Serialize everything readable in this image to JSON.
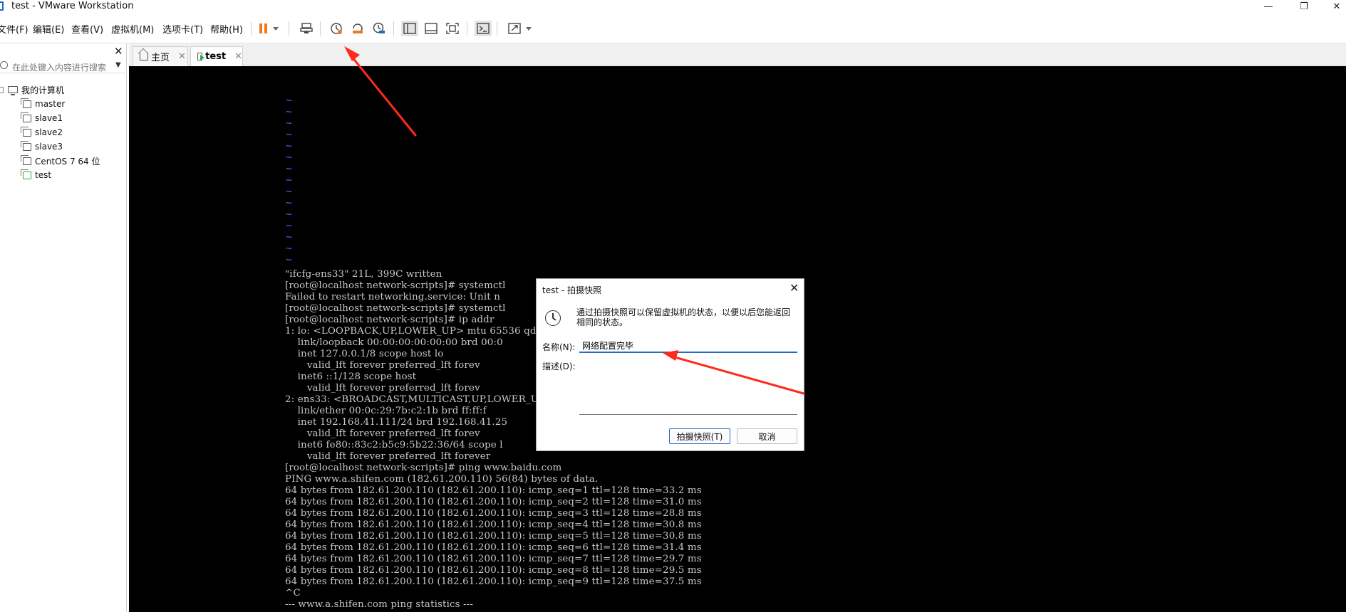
{
  "window": {
    "title": "test - VMware Workstation",
    "controls": {
      "minimize": "—",
      "restore": "❐",
      "close": "✕"
    }
  },
  "menu": [
    {
      "key": "file",
      "label": "文件(F)"
    },
    {
      "key": "edit",
      "label": "编辑(E)"
    },
    {
      "key": "view",
      "label": "查看(V)"
    },
    {
      "key": "vm",
      "label": "虚拟机(M)"
    },
    {
      "key": "tabs",
      "label": "选项卡(T)"
    },
    {
      "key": "help",
      "label": "帮助(H)"
    }
  ],
  "toolbar": {
    "icons": [
      "pause-icon",
      "dropdown-icon",
      "send-ctrl-alt-del-icon",
      "take-snapshot-icon",
      "revert-snapshot-icon",
      "snapshot-manager-icon",
      "library-view-icon",
      "thumbnail-bar-icon",
      "fullscreen-icon",
      "console-view-icon",
      "stretch-guest-icon"
    ],
    "accent": "#f07a1a"
  },
  "library": {
    "close": "✕",
    "search_placeholder": "在此处键入内容进行搜索",
    "dropdown": "▼",
    "root_label": "我的计算机",
    "items": [
      {
        "label": "master"
      },
      {
        "label": "slave1"
      },
      {
        "label": "slave2"
      },
      {
        "label": "slave3"
      },
      {
        "label": "CentOS 7 64 位"
      },
      {
        "label": "test"
      }
    ]
  },
  "tabs": [
    {
      "label": "主页",
      "close": "✕",
      "active": false
    },
    {
      "label": "test",
      "close": "✕",
      "active": true
    }
  ],
  "console": {
    "tilde": "~",
    "lines": [
      "\"ifcfg-ens33\" 21L, 399C written",
      "[root@localhost network-scripts]# systemctl",
      "Failed to restart networking.service: Unit n",
      "[root@localhost network-scripts]# systemctl",
      "[root@localhost network-scripts]# ip addr",
      "1: lo: <LOOPBACK,UP,LOWER_UP> mtu 65536 qdis",
      "    link/loopback 00:00:00:00:00:00 brd 00:0",
      "    inet 127.0.0.1/8 scope host lo",
      "       valid_lft forever preferred_lft forev",
      "    inet6 ::1/128 scope host",
      "       valid_lft forever preferred_lft forev",
      "2: ens33: <BROADCAST,MULTICAST,UP,LOWER_UP>",
      "    link/ether 00:0c:29:7b:c2:1b brd ff:ff:f",
      "    inet 192.168.41.111/24 brd 192.168.41.25",
      "       valid_lft forever preferred_lft forev",
      "    inet6 fe80::83c2:b5c9:5b22:36/64 scope l",
      "       valid_lft forever preferred_lft forever",
      "[root@localhost network-scripts]# ping www.baidu.com",
      "PING www.a.shifen.com (182.61.200.110) 56(84) bytes of data.",
      "64 bytes from 182.61.200.110 (182.61.200.110): icmp_seq=1 ttl=128 time=33.2 ms",
      "64 bytes from 182.61.200.110 (182.61.200.110): icmp_seq=2 ttl=128 time=31.0 ms",
      "64 bytes from 182.61.200.110 (182.61.200.110): icmp_seq=3 ttl=128 time=28.8 ms",
      "64 bytes from 182.61.200.110 (182.61.200.110): icmp_seq=4 ttl=128 time=30.8 ms",
      "64 bytes from 182.61.200.110 (182.61.200.110): icmp_seq=5 ttl=128 time=30.8 ms",
      "64 bytes from 182.61.200.110 (182.61.200.110): icmp_seq=6 ttl=128 time=31.4 ms",
      "64 bytes from 182.61.200.110 (182.61.200.110): icmp_seq=7 ttl=128 time=29.7 ms",
      "64 bytes from 182.61.200.110 (182.61.200.110): icmp_seq=8 ttl=128 time=29.5 ms",
      "64 bytes from 182.61.200.110 (182.61.200.110): icmp_seq=9 ttl=128 time=37.5 ms",
      "^C",
      "--- www.a.shifen.com ping statistics ---"
    ]
  },
  "snapshot_dialog": {
    "title": "test - 拍摄快照",
    "close": "✕",
    "description": "通过拍摄快照可以保留虚拟机的状态，以便以后您能返回相同的状态。",
    "name_label": "名称(N):",
    "name_value": "网络配置完毕",
    "desc_label": "描述(D):",
    "desc_value": "",
    "take_button": "拍摄快照(T)",
    "cancel_button": "取消"
  },
  "annotation_color": "#ff2a1a"
}
